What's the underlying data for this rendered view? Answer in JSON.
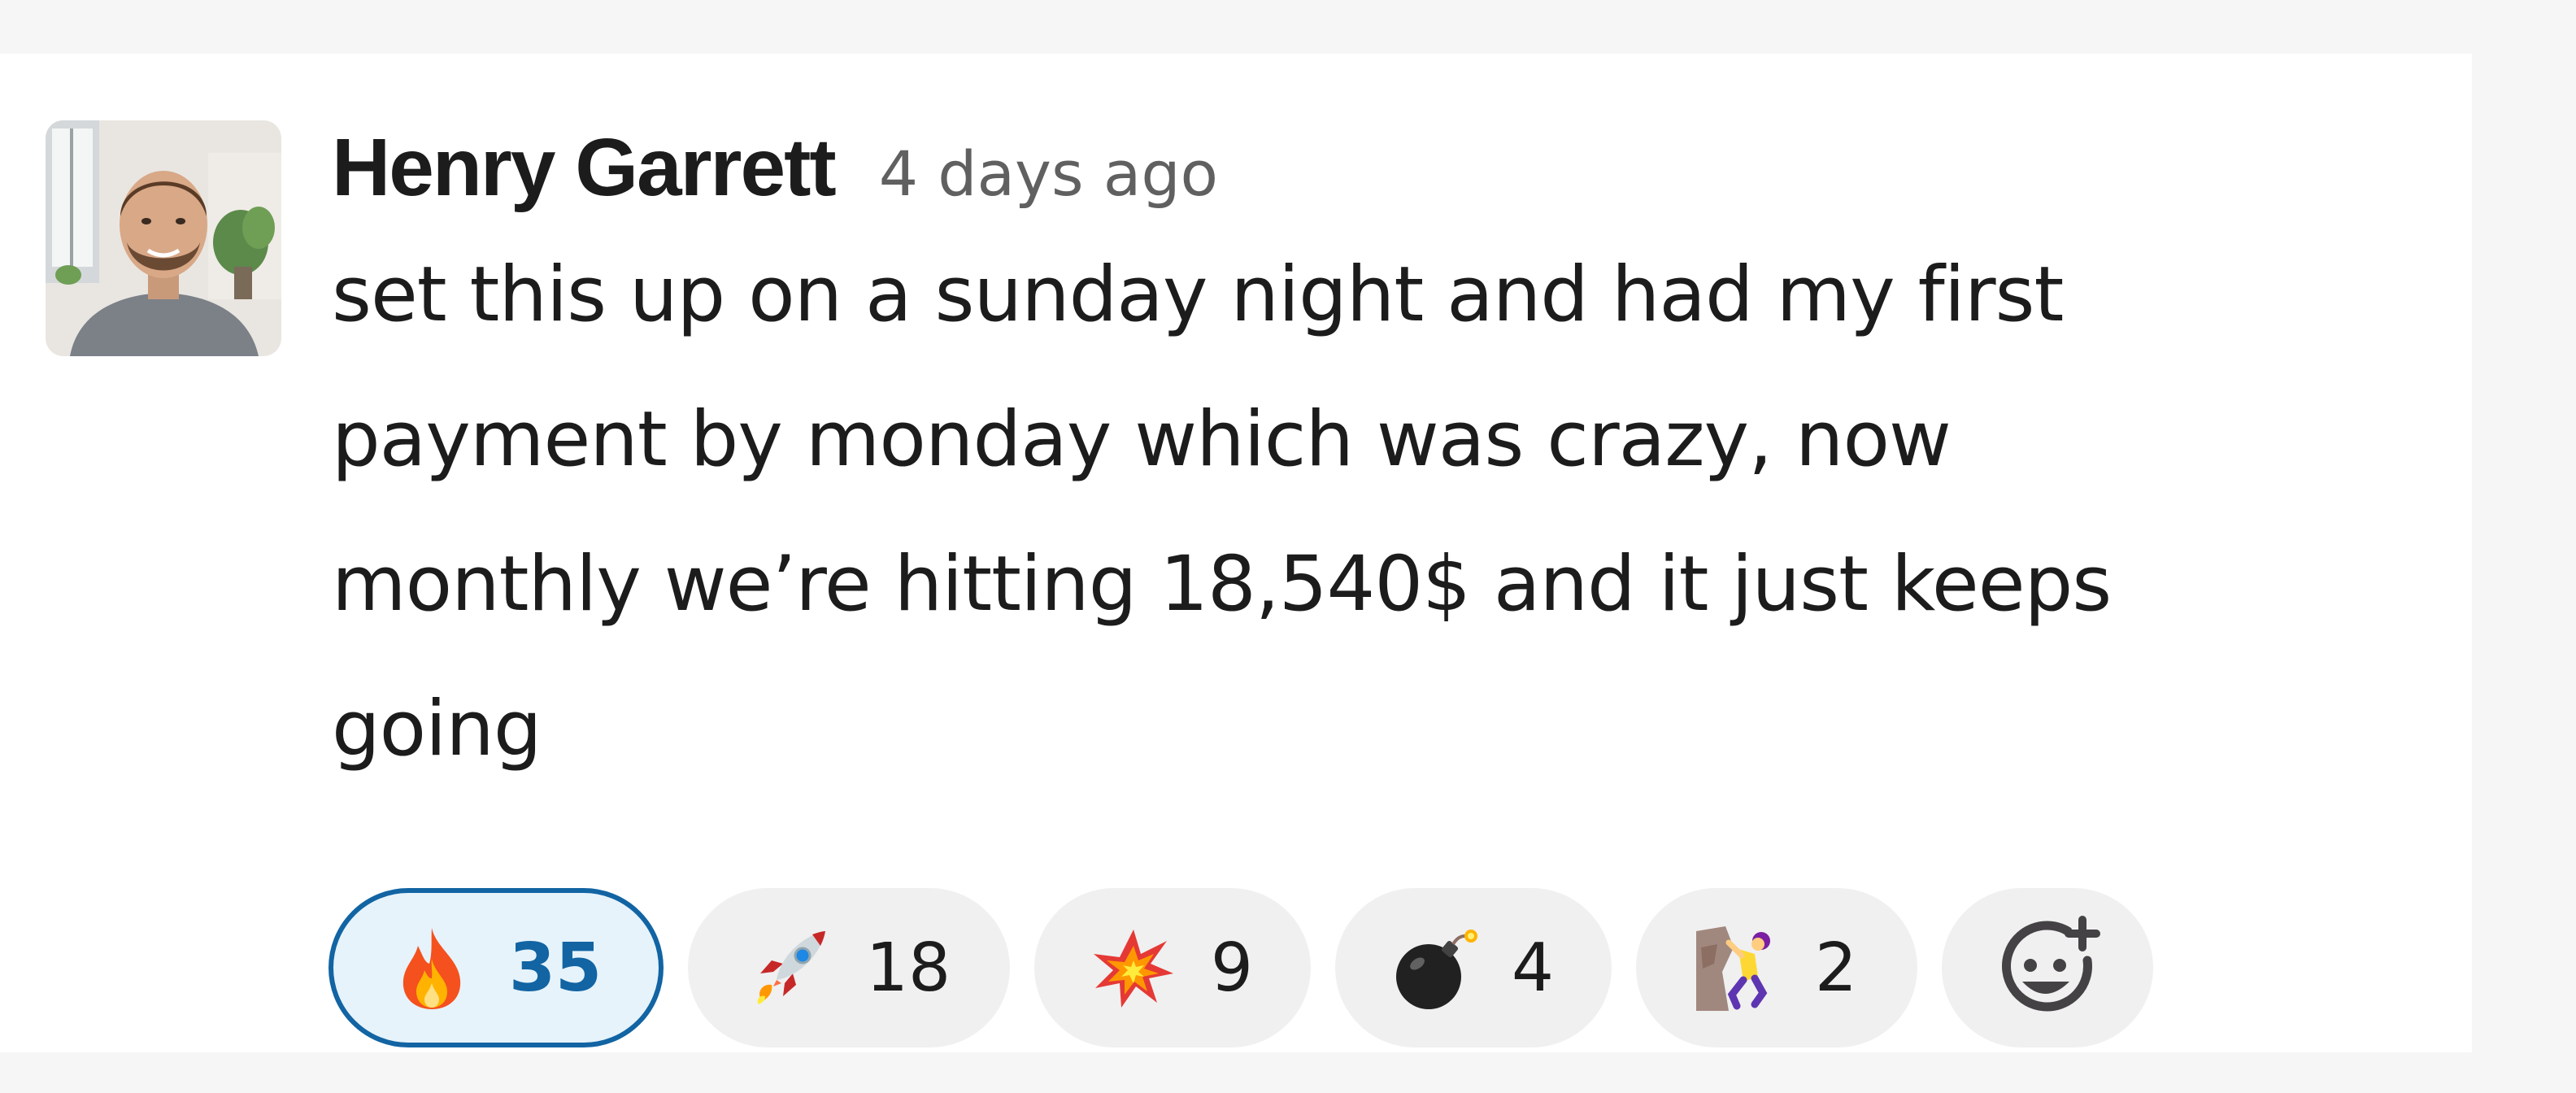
{
  "message": {
    "author": "Henry Garrett",
    "timestamp": "4 days ago",
    "lines": [
      "set this up on a sunday night and had my first",
      "payment by monday which was crazy, now",
      "monthly we’re hitting 18,540$ and it just keeps",
      "going"
    ]
  },
  "reactions": [
    {
      "emoji": "fire-emoji",
      "count": "35",
      "selected": true
    },
    {
      "emoji": "rocket-emoji",
      "count": "18",
      "selected": false
    },
    {
      "emoji": "collision-emoji",
      "count": "9",
      "selected": false
    },
    {
      "emoji": "bomb-emoji",
      "count": "4",
      "selected": false
    },
    {
      "emoji": "climber-emoji",
      "count": "2",
      "selected": false
    }
  ],
  "add_reaction": {
    "icon": "add-reaction-icon"
  },
  "colors": {
    "selected_border": "#1264a3",
    "selected_bg": "#e6f3fb",
    "pill_bg": "#f0f0f0",
    "text": "#1d1c1d",
    "muted": "#616061"
  }
}
